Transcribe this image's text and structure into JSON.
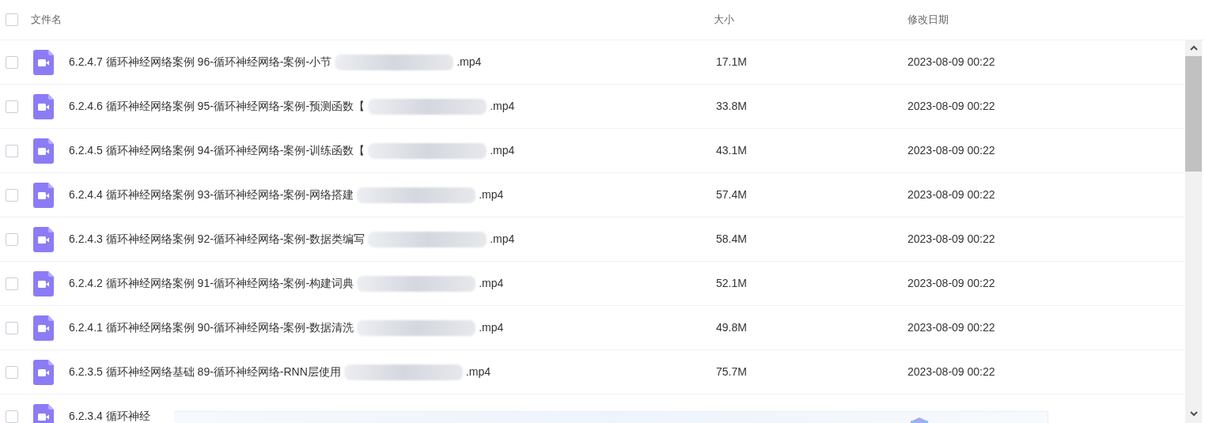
{
  "header": {
    "checked": false,
    "columns": [
      "文件名",
      "大小",
      "修改日期"
    ]
  },
  "rows": [
    {
      "checked": false,
      "name": "6.2.4.7 循环神经网络案例 96-循环神经网络-案例-小节",
      "extension": ".mp4",
      "size": "17.1M",
      "date": "2023-08-09 00:22"
    },
    {
      "checked": false,
      "name": "6.2.4.6 循环神经网络案例 95-循环神经网络-案例-预测函数【",
      "extension": ".mp4",
      "size": "33.8M",
      "date": "2023-08-09 00:22"
    },
    {
      "checked": false,
      "name": "6.2.4.5 循环神经网络案例 94-循环神经网络-案例-训练函数【",
      "extension": ".mp4",
      "size": "43.1M",
      "date": "2023-08-09 00:22"
    },
    {
      "checked": false,
      "name": "6.2.4.4 循环神经网络案例 93-循环神经网络-案例-网络搭建",
      "extension": ".mp4",
      "size": "57.4M",
      "date": "2023-08-09 00:22"
    },
    {
      "checked": false,
      "name": "6.2.4.3 循环神经网络案例 92-循环神经网络-案例-数据类编写",
      "extension": ".mp4",
      "size": "58.4M",
      "date": "2023-08-09 00:22"
    },
    {
      "checked": false,
      "name": "6.2.4.2 循环神经网络案例 91-循环神经网络-案例-构建词典",
      "extension": ".mp4",
      "size": "52.1M",
      "date": "2023-08-09 00:22"
    },
    {
      "checked": false,
      "name": "6.2.4.1 循环神经网络案例 90-循环神经网络-案例-数据清洗",
      "extension": ".mp4",
      "size": "49.8M",
      "date": "2023-08-09 00:22"
    },
    {
      "checked": false,
      "name": "6.2.3.5 循环神经网络基础 89-循环神经网络-RNN层使用",
      "extension": ".mp4",
      "size": "75.7M",
      "date": "2023-08-09 00:22"
    },
    {
      "checked": false,
      "name": "6.2.3.4 循环神经"
    }
  ]
}
